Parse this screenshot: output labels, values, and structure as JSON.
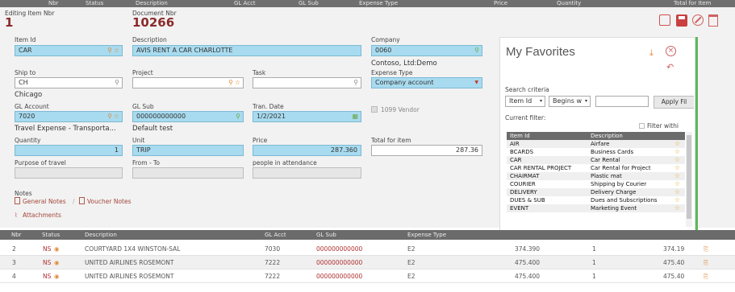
{
  "topbar": {
    "cols": [
      "Nbr",
      "Status",
      "Description",
      "GL Acct",
      "GL Sub",
      "Expense Type",
      "Price",
      "Quantity",
      "Total for Item"
    ]
  },
  "header": {
    "editing_label": "Editing Item Nbr",
    "editing_value": "1",
    "doc_label": "Document Nbr",
    "doc_value": "10266"
  },
  "form": {
    "item_id": {
      "label": "Item Id",
      "value": "CAR"
    },
    "description": {
      "label": "Description",
      "value": "AVIS RENT A CAR   CHARLOTTE"
    },
    "company": {
      "label": "Company",
      "value": "0060",
      "sub": "Contoso, Ltd:Demo"
    },
    "ship_to": {
      "label": "Ship to",
      "value": "CH",
      "sub": "Chicago"
    },
    "project": {
      "label": "Project",
      "value": ""
    },
    "task": {
      "label": "Task",
      "value": ""
    },
    "expense_type": {
      "label": "Expense Type",
      "value": "Company account"
    },
    "gl_account": {
      "label": "GL Account",
      "value": "7020",
      "sub": "Travel Expense - Transporta..."
    },
    "gl_sub": {
      "label": "GL Sub",
      "value": "000000000000",
      "sub": "Default test"
    },
    "tran_date": {
      "label": "Tran. Date",
      "value": "1/2/2021"
    },
    "vendor_1099": {
      "label": "1099 Vendor"
    },
    "quantity": {
      "label": "Quantity",
      "value": "1"
    },
    "unit": {
      "label": "Unit",
      "value": "TRIP"
    },
    "price": {
      "label": "Price",
      "value": "287.360"
    },
    "total_for_item": {
      "label": "Total for item",
      "value": "287.36"
    },
    "purpose": {
      "label": "Purpose of travel",
      "value": ""
    },
    "from_to": {
      "label": "From - To",
      "value": ""
    },
    "people": {
      "label": "people in attendance",
      "value": ""
    },
    "notes_label": "Notes",
    "general_notes": "General Notes",
    "voucher_notes": "Voucher Notes",
    "attachments": "Attachments"
  },
  "favorites": {
    "title": "My Favorites",
    "search_criteria": "Search criteria",
    "field_select": "Item Id",
    "op_select": "Begins w",
    "apply": "Apply Fil",
    "current_filter": "Current filter:",
    "filter_within": "Filter withi",
    "col_item": "Item Id",
    "col_desc": "Description",
    "rows": [
      {
        "id": "AIR",
        "desc": "Airfare"
      },
      {
        "id": "BCARDS",
        "desc": "Business Cards"
      },
      {
        "id": "CAR",
        "desc": "Car Rental"
      },
      {
        "id": "CAR RENTAL PROJECT",
        "desc": "Car Rental for Project"
      },
      {
        "id": "CHAIRMAT",
        "desc": "Plastic mat"
      },
      {
        "id": "COURIER",
        "desc": "Shipping by Courier"
      },
      {
        "id": "DELIVERY",
        "desc": "Delivery Charge"
      },
      {
        "id": "DUES & SUB",
        "desc": "Dues and Subscriptions"
      },
      {
        "id": "EVENT",
        "desc": "Marketing Event"
      }
    ]
  },
  "grid": {
    "headers": [
      "Nbr",
      "Status",
      "Description",
      "GL Acct",
      "GL Sub",
      "Expense Type"
    ],
    "rows": [
      {
        "nbr": "2",
        "status": "NS",
        "desc": "COURTYARD 1X4 WINSTON-SAL",
        "acct": "7030",
        "sub": "000000000000",
        "type": "E2",
        "price": "374.390",
        "qty": "1",
        "total": "374.19"
      },
      {
        "nbr": "3",
        "status": "NS",
        "desc": "UNITED AIRLINES ROSEMONT",
        "acct": "7222",
        "sub": "000000000000",
        "type": "E2",
        "price": "475.400",
        "qty": "1",
        "total": "475.40"
      },
      {
        "nbr": "4",
        "status": "NS",
        "desc": "UNITED AIRLINES ROSEMONT",
        "acct": "7222",
        "sub": "000000000000",
        "type": "E2",
        "price": "475.400",
        "qty": "1",
        "total": "475.40"
      }
    ]
  },
  "colors": {
    "accent_red": "#b03030",
    "field_blue": "#a8dbef",
    "header_gray": "#6b6b6b"
  }
}
